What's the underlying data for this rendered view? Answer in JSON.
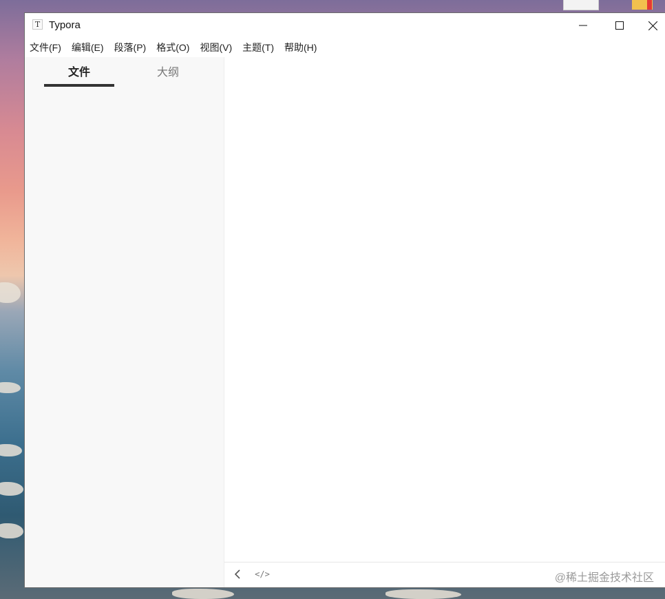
{
  "window": {
    "title": "Typora",
    "app_icon_glyph": "T"
  },
  "menu": {
    "items": [
      {
        "label": "文件(F)"
      },
      {
        "label": "编辑(E)"
      },
      {
        "label": "段落(P)"
      },
      {
        "label": "格式(O)"
      },
      {
        "label": "视图(V)"
      },
      {
        "label": "主题(T)"
      },
      {
        "label": "帮助(H)"
      }
    ]
  },
  "sidebar": {
    "tabs": [
      {
        "label": "文件",
        "active": true
      },
      {
        "label": "大纲",
        "active": false
      }
    ]
  },
  "footer": {
    "source_mode_glyph": "</>",
    "watermark": "@稀土掘金技术社区"
  },
  "icons": {
    "app": "typora-app-icon",
    "minimize": "minimize-icon",
    "maximize": "maximize-icon",
    "close": "close-icon",
    "back": "chevron-left-icon",
    "source": "code-icon"
  },
  "colors": {
    "window_bg": "#ffffff",
    "sidebar_bg": "#f8f8f8",
    "active_tab_underline": "#333333",
    "inactive_tab_text": "#777777"
  }
}
